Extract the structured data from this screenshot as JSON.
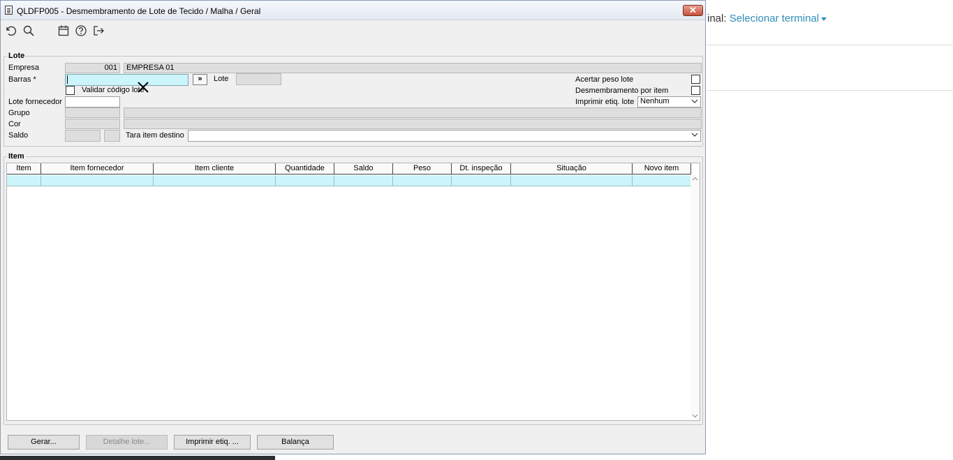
{
  "background": {
    "terminal_label": "inal:",
    "terminal_link": "Selecionar terminal"
  },
  "window": {
    "title": "QLDFP005 - Desmembramento de Lote de Tecido / Malha / Geral",
    "close_glyph": "✕"
  },
  "toolbar": {
    "icons": [
      "undo-icon",
      "search-icon",
      "calendar-icon",
      "help-icon",
      "exit-icon"
    ]
  },
  "lote": {
    "group_label": "Lote",
    "empresa_label": "Empresa",
    "empresa_code": "001",
    "empresa_name": "EMPRESA 01",
    "barras_label": "Barras *",
    "barras_value": "",
    "barras_button": "»",
    "lote_label": "Lote",
    "lote_value": "",
    "validar_label": "Validar código lote",
    "validar_checked": false,
    "lote_fornecedor_label": "Lote fornecedor",
    "lote_fornecedor_value": "",
    "grupo_label": "Grupo",
    "cor_label": "Cor",
    "saldo_label": "Saldo",
    "tara_label": "Tara item destino",
    "tara_value": "",
    "acertar_label": "Acertar peso lote",
    "acertar_checked": false,
    "desmembramento_label": "Desmembramento por item",
    "desmembramento_checked": false,
    "imprimir_label": "Imprimir etiq. lote",
    "imprimir_value": "Nenhum"
  },
  "item": {
    "group_label": "Item",
    "columns": [
      "Item",
      "Item fornecedor",
      "Item cliente",
      "Quantidade",
      "Saldo",
      "Peso",
      "Dt. inspeção",
      "Situação",
      "Novo item"
    ],
    "rows": [
      [
        "",
        "",
        "",
        "",
        "",
        "",
        "",
        "",
        ""
      ]
    ]
  },
  "buttons": {
    "gerar": "Gerar...",
    "detalhe": "Detalhe lote...",
    "imprimir": "Imprimir etiq. ...",
    "balanca": "Balança"
  },
  "colors": {
    "input_highlight": "#ccf4fb",
    "readonly": "#dedede",
    "link": "#2f8fb8",
    "close_button": "#c7503a"
  }
}
